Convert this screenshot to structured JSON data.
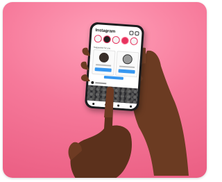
{
  "phone": {
    "app_title": "Instagram",
    "suggestions_label": "Suggested for you"
  },
  "colors": {
    "background": "#f6799a",
    "accent": "#3797f0",
    "story_ring": "#e6335e",
    "skin": "#6b3b22"
  },
  "icons": [
    "heart-icon",
    "messenger-icon",
    "home-icon",
    "search-icon",
    "reels-icon",
    "profile-icon"
  ]
}
